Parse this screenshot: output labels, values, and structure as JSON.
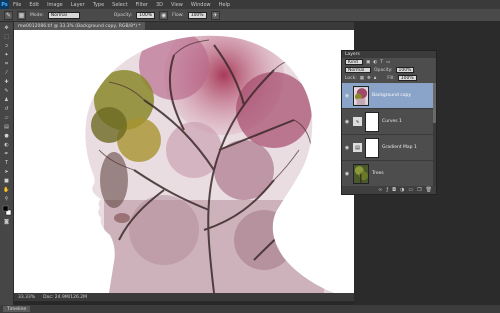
{
  "app": {
    "logo": "Ps"
  },
  "menu": [
    "File",
    "Edit",
    "Image",
    "Layer",
    "Type",
    "Select",
    "Filter",
    "3D",
    "View",
    "Window",
    "Help"
  ],
  "options": {
    "mode_label": "Mode:",
    "mode_value": "Normal",
    "opacity_label": "Opacity:",
    "opacity_value": "100%",
    "flow_label": "Flow:",
    "flow_value": "100%"
  },
  "document": {
    "tab_title": "mw0012086.tif @ 33.3% (Background copy, RGB/8*) *",
    "status_zoom": "33.33%",
    "status_doc": "Doc: 24.9M/126.2M"
  },
  "bottom": {
    "tab": "Timeline"
  },
  "layers_panel": {
    "title": "Layers",
    "kind_label": "Kind",
    "blend_mode": "Normal",
    "opacity_label": "Opacity:",
    "opacity_value": "100%",
    "lock_label": "Lock:",
    "fill_label": "Fill:",
    "fill_value": "100%",
    "layers": [
      {
        "name": "Background copy",
        "type": "image",
        "active": true
      },
      {
        "name": "Curves 1",
        "type": "adjustment",
        "active": false
      },
      {
        "name": "Gradient Map 1",
        "type": "adjustment",
        "active": false
      },
      {
        "name": "Trees",
        "type": "image",
        "active": false
      }
    ],
    "footer_icons": [
      "link-icon",
      "fx-icon",
      "mask-icon",
      "adjustment-icon",
      "folder-icon",
      "new-layer-icon",
      "trash-icon"
    ]
  },
  "colors": {
    "accent": "#8aa3c8",
    "workspace": "#282828",
    "panel": "#4d4d4d"
  }
}
